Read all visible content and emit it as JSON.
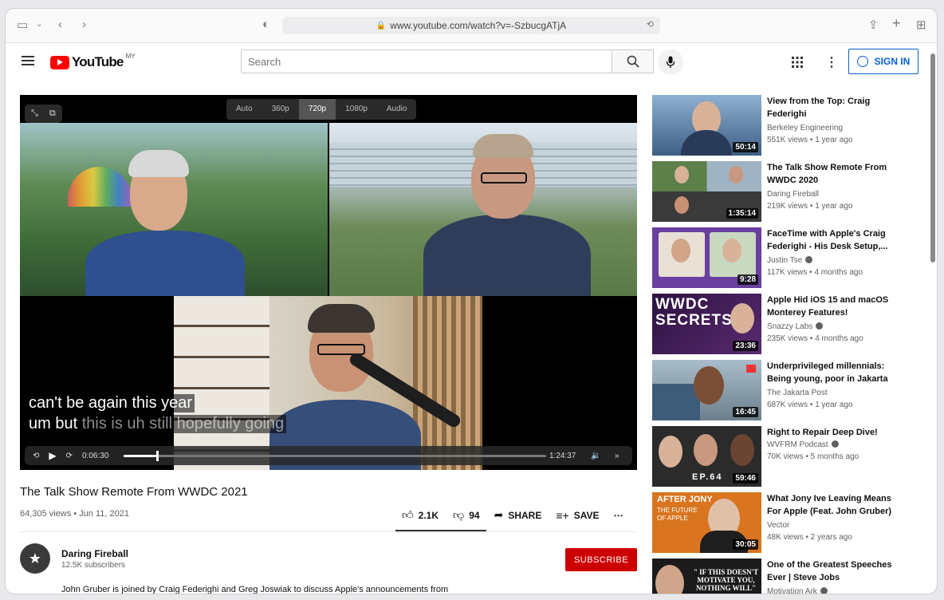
{
  "browser": {
    "url": "www.youtube.com/watch?v=-SzbucgATjA"
  },
  "header": {
    "logo_text": "YouTube",
    "country": "MY",
    "search_placeholder": "Search",
    "sign_in": "SIGN IN"
  },
  "player": {
    "qualities": [
      "Auto",
      "360p",
      "720p",
      "1080p",
      "Audio"
    ],
    "selected_quality": "720p",
    "caption_line1": "can't be again this year",
    "caption_line2_a": "um but ",
    "caption_line2_b": "this is uh still hopefully going",
    "current_time": "0:06:30",
    "duration": "1:24:37",
    "progress": 0.077
  },
  "video": {
    "title": "The Talk Show Remote From WWDC 2021",
    "meta": "64,305 views • Jun 11, 2021",
    "likes": "2.1K",
    "dislikes": "94",
    "share": "SHARE",
    "save": "SAVE"
  },
  "channel": {
    "name": "Daring Fireball",
    "subscribers": "12.5K subscribers",
    "subscribe": "SUBSCRIBE",
    "description": "John Gruber is joined by Craig Federighi and Greg Joswiak to discuss Apple's announcements from"
  },
  "recommendations": [
    {
      "title": "View from the Top: Craig Federighi",
      "channel": "Berkeley Engineering",
      "verified": false,
      "views": "551K views • 1 year ago",
      "duration": "50:14",
      "color": "#6d8fb3"
    },
    {
      "title": "The Talk Show Remote From WWDC 2020",
      "channel": "Daring Fireball",
      "verified": false,
      "views": "219K views • 1 year ago",
      "duration": "1:35:14",
      "color": "#4e6f3e"
    },
    {
      "title": "FaceTime with Apple's Craig Federighi - His Desk Setup,...",
      "channel": "Justin Tse",
      "verified": true,
      "views": "117K views • 4 months ago",
      "duration": "9:28",
      "color": "#6a3fa0"
    },
    {
      "title": "Apple Hid iOS 15 and macOS Monterey Features!",
      "channel": "Snazzy Labs",
      "verified": true,
      "views": "235K views • 4 months ago",
      "duration": "23:36",
      "color": "#3a1e55"
    },
    {
      "title": "Underprivileged millennials: Being young, poor in Jakarta",
      "channel": "The Jakarta Post",
      "verified": false,
      "views": "687K views • 1 year ago",
      "duration": "16:45",
      "color": "#8aa0b4"
    },
    {
      "title": "Right to Repair Deep Dive!",
      "channel": "WVFRM Podcast",
      "verified": true,
      "views": "70K views • 5 months ago",
      "duration": "59:46",
      "color": "#2b2b2b"
    },
    {
      "title": "What Jony Ive Leaving Means For Apple (Feat. John Gruber)",
      "channel": "Vector",
      "verified": false,
      "views": "48K views • 2 years ago",
      "duration": "30:05",
      "color": "#d9751f"
    },
    {
      "title": "One of the Greatest Speeches Ever | Steve Jobs",
      "channel": "Motivation Ark",
      "verified": true,
      "views": "",
      "duration": "",
      "color": "#1b1b1b"
    }
  ],
  "thumb_text": {
    "r3": "WWDC SECRETS",
    "r5": "EP.64",
    "r6": "AFTER JONY",
    "r6b": "THE FUTURE OF APPLE",
    "r7": "\" IF THIS DOESN'T MOTIVATE YOU, NOTHING WILL\""
  }
}
